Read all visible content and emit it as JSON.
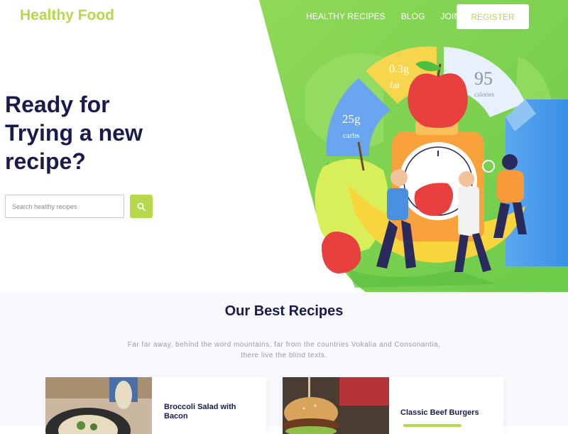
{
  "brand": "Healthy Food",
  "nav": {
    "items": [
      "HEALTHY RECIPES",
      "BLOG",
      "JOIN"
    ],
    "register_label": "REGISTER"
  },
  "hero": {
    "headline_lines": [
      "Ready for",
      "Trying a new",
      "recipe?"
    ],
    "search_placeholder": "Search healthy recipes",
    "nutrition": {
      "fat_value": "0.3g",
      "fat_label": "fat",
      "calories_value": "95",
      "calories_label": "calories",
      "carbs_value": "25g",
      "carbs_label": "carbs"
    }
  },
  "recipes": {
    "title": "Our Best Recipes",
    "subtitle_lines": [
      "Far far away, behind the word mountains, far from the countries Vokalia and Consonantia,",
      "there live the blind texts."
    ],
    "cards": [
      {
        "title": "Broccoli Salad with Bacon"
      },
      {
        "title": "Classic Beef Burgers"
      }
    ]
  },
  "colors": {
    "brand_green": "#b6d84d",
    "hero_green": "#7dd04f",
    "navy": "#1b1a4e"
  },
  "icons": [
    "search-icon"
  ]
}
